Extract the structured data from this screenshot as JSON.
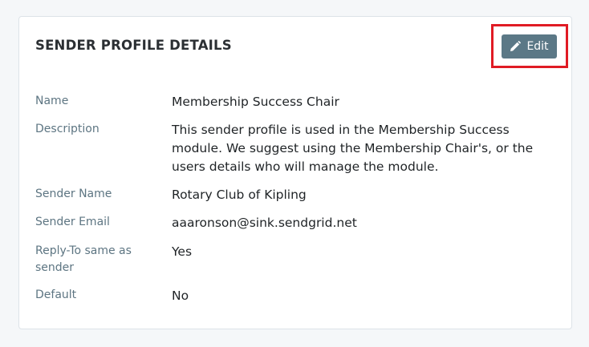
{
  "card": {
    "title": "SENDER PROFILE DETAILS",
    "edit_label": "Edit"
  },
  "fields": [
    {
      "label": "Name",
      "value": "Membership Success Chair"
    },
    {
      "label": "Description",
      "value": "This sender profile is used in the Membership Success module. We suggest using the Membership Chair's, or the users details who will manage the module."
    },
    {
      "label": "Sender Name",
      "value": "Rotary Club of Kipling"
    },
    {
      "label": "Sender Email",
      "value": "aaaronson@sink.sendgrid.net"
    },
    {
      "label": "Reply-To same as sender",
      "value": "Yes"
    },
    {
      "label": "Default",
      "value": "No"
    }
  ],
  "icons": {
    "edit": "pencil-icon"
  },
  "colors": {
    "button_bg": "#5b7886",
    "highlight": "#e01b24",
    "label": "#5d7582"
  }
}
